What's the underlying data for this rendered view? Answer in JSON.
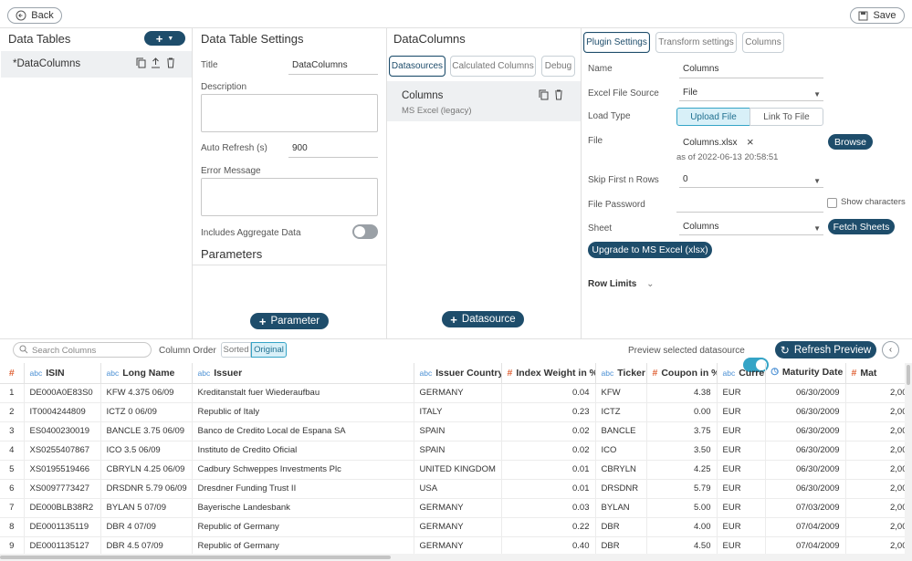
{
  "toolbar": {
    "back_label": "Back",
    "save_label": "Save"
  },
  "data_tables": {
    "title": "Data Tables",
    "add_label": "+",
    "items": [
      {
        "label": "*DataColumns"
      }
    ]
  },
  "settings": {
    "title": "Data Table Settings",
    "title_label": "Title",
    "title_value": "DataColumns",
    "description_label": "Description",
    "auto_refresh_label": "Auto Refresh (s)",
    "auto_refresh_value": "900",
    "error_label": "Error Message",
    "aggregate_label": "Includes Aggregate Data",
    "aggregate_on": false,
    "parameters_title": "Parameters",
    "parameter_button": "Parameter"
  },
  "datacolumns": {
    "title": "DataColumns",
    "tabs": [
      {
        "label": "Datasources",
        "active": true
      },
      {
        "label": "Calculated Columns",
        "active": false
      },
      {
        "label": "Debug",
        "active": false
      }
    ],
    "datasource": {
      "name": "Columns",
      "type": "MS Excel (legacy)"
    },
    "add_button": "Datasource"
  },
  "plugin": {
    "tabs": [
      {
        "label": "Plugin Settings",
        "active": true
      },
      {
        "label": "Transform settings",
        "active": false
      },
      {
        "label": "Columns",
        "active": false
      }
    ],
    "name_label": "Name",
    "name_value": "Columns",
    "source_label": "Excel File Source",
    "source_value": "File",
    "load_type_label": "Load Type",
    "load_upload": "Upload File",
    "load_link": "Link To File",
    "file_label": "File",
    "file_value": "Columns.xlsx",
    "file_date": "as of 2022-06-13 20:58:51",
    "browse_label": "Browse",
    "skip_label": "Skip First n Rows",
    "skip_value": "0",
    "password_label": "File Password",
    "show_chars_label": "Show characters",
    "sheet_label": "Sheet",
    "sheet_value": "Columns",
    "fetch_label": "Fetch Sheets",
    "upgrade_label": "Upgrade to MS Excel (xlsx)",
    "row_limits_label": "Row Limits"
  },
  "preview": {
    "search_placeholder": "Search Columns",
    "column_order_label": "Column Order",
    "sorted_label": "Sorted",
    "original_label": "Original",
    "preview_label": "Preview selected datasource",
    "refresh_label": "Refresh Preview"
  },
  "grid": {
    "columns": [
      {
        "type": "#",
        "label": ""
      },
      {
        "type": "abc",
        "label": "ISIN"
      },
      {
        "type": "abc",
        "label": "Long Name"
      },
      {
        "type": "abc",
        "label": "Issuer"
      },
      {
        "type": "abc",
        "label": "Issuer Country"
      },
      {
        "type": "#",
        "label": "Index Weight in %"
      },
      {
        "type": "abc",
        "label": "Ticker"
      },
      {
        "type": "#",
        "label": "Coupon in %"
      },
      {
        "type": "abc",
        "label": "Currency"
      },
      {
        "type": "clock",
        "label": "Maturity Date"
      },
      {
        "type": "#",
        "label": "Mat"
      }
    ],
    "rows": [
      [
        "1",
        "DE000A0E83S0",
        "KFW 4.375 06/09",
        "Kreditanstalt fuer Wiederaufbau",
        "GERMANY",
        "0.04",
        "KFW",
        "4.38",
        "EUR",
        "06/30/2009",
        "2,00"
      ],
      [
        "2",
        "IT0004244809",
        "ICTZ 0 06/09",
        "Republic of Italy",
        "ITALY",
        "0.23",
        "ICTZ",
        "0.00",
        "EUR",
        "06/30/2009",
        "2,00"
      ],
      [
        "3",
        "ES0400230019",
        "BANCLE 3.75 06/09",
        "Banco de Credito Local de Espana SA",
        "SPAIN",
        "0.02",
        "BANCLE",
        "3.75",
        "EUR",
        "06/30/2009",
        "2,00"
      ],
      [
        "4",
        "XS0255407867",
        "ICO 3.5 06/09",
        "Instituto de Credito Oficial",
        "SPAIN",
        "0.02",
        "ICO",
        "3.50",
        "EUR",
        "06/30/2009",
        "2,00"
      ],
      [
        "5",
        "XS0195519466",
        "CBRYLN 4.25 06/09",
        "Cadbury Schweppes Investments Plc",
        "UNITED KINGDOM",
        "0.01",
        "CBRYLN",
        "4.25",
        "EUR",
        "06/30/2009",
        "2,00"
      ],
      [
        "6",
        "XS0097773427",
        "DRSDNR 5.79 06/09",
        "Dresdner Funding Trust II",
        "USA",
        "0.01",
        "DRSDNR",
        "5.79",
        "EUR",
        "06/30/2009",
        "2,00"
      ],
      [
        "7",
        "DE000BLB38R2",
        "BYLAN 5 07/09",
        "Bayerische Landesbank",
        "GERMANY",
        "0.03",
        "BYLAN",
        "5.00",
        "EUR",
        "07/03/2009",
        "2,00"
      ],
      [
        "8",
        "DE0001135119",
        "DBR 4 07/09",
        "Republic of Germany",
        "GERMANY",
        "0.22",
        "DBR",
        "4.00",
        "EUR",
        "07/04/2009",
        "2,00"
      ],
      [
        "9",
        "DE0001135127",
        "DBR 4.5 07/09",
        "Republic of Germany",
        "GERMANY",
        "0.40",
        "DBR",
        "4.50",
        "EUR",
        "07/04/2009",
        "2,00"
      ]
    ]
  },
  "colors": {
    "accent": "#1e4d6b",
    "toggle_on": "#35a4c6",
    "number_type": "#e0653a",
    "text_type": "#4a8fd4"
  }
}
